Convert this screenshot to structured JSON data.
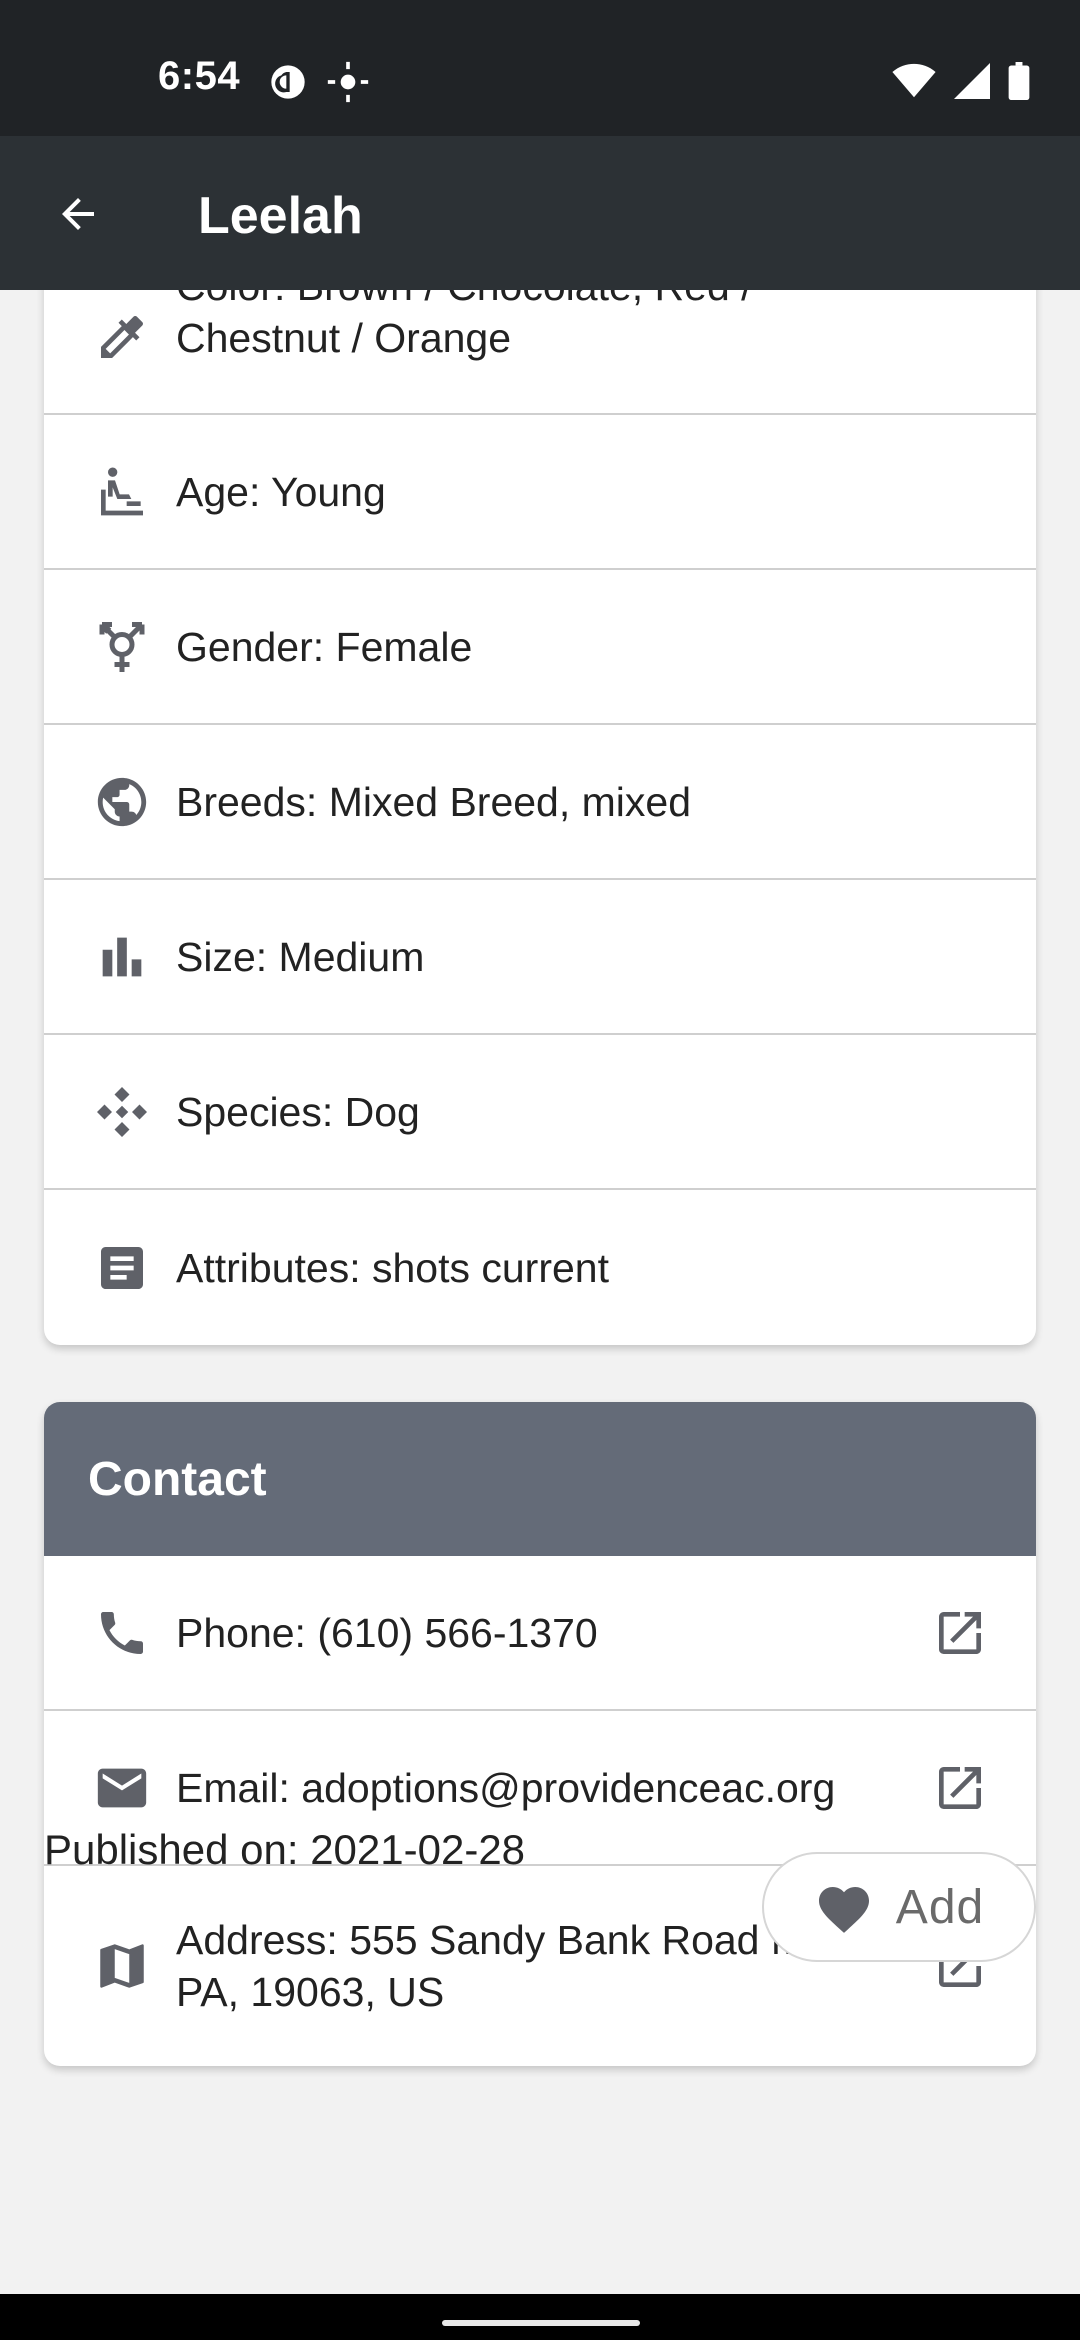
{
  "status_bar": {
    "time": "6:54"
  },
  "app_bar": {
    "title": "Leelah"
  },
  "details": [
    {
      "icon": "eyedropper-icon",
      "text": "Color: Brown / Chocolate, Red / Chestnut / Orange"
    },
    {
      "icon": "baby-changing-icon",
      "text": "Age: Young"
    },
    {
      "icon": "gender-icon",
      "text": "Gender: Female"
    },
    {
      "icon": "globe-icon",
      "text": "Breeds: Mixed Breed, mixed"
    },
    {
      "icon": "bar-chart-icon",
      "text": "Size: Medium"
    },
    {
      "icon": "species-icon",
      "text": "Species: Dog"
    },
    {
      "icon": "document-icon",
      "text": "Attributes: shots current"
    }
  ],
  "contact": {
    "header": "Contact",
    "items": [
      {
        "icon": "phone-icon",
        "text": "Phone: (610) 566-1370"
      },
      {
        "icon": "email-icon",
        "text": "Email: adoptions@providenceac.org"
      },
      {
        "icon": "map-icon",
        "text": "Address: 555 Sandy Bank Road Media, PA, 19063, US"
      }
    ]
  },
  "published": "Published on: 2021-02-28",
  "add_button": {
    "label": "Add"
  },
  "colors": {
    "status_bar": "#202326",
    "app_bar": "#2c3135",
    "contact_header": "#646b78",
    "icon": "#5f6168"
  }
}
